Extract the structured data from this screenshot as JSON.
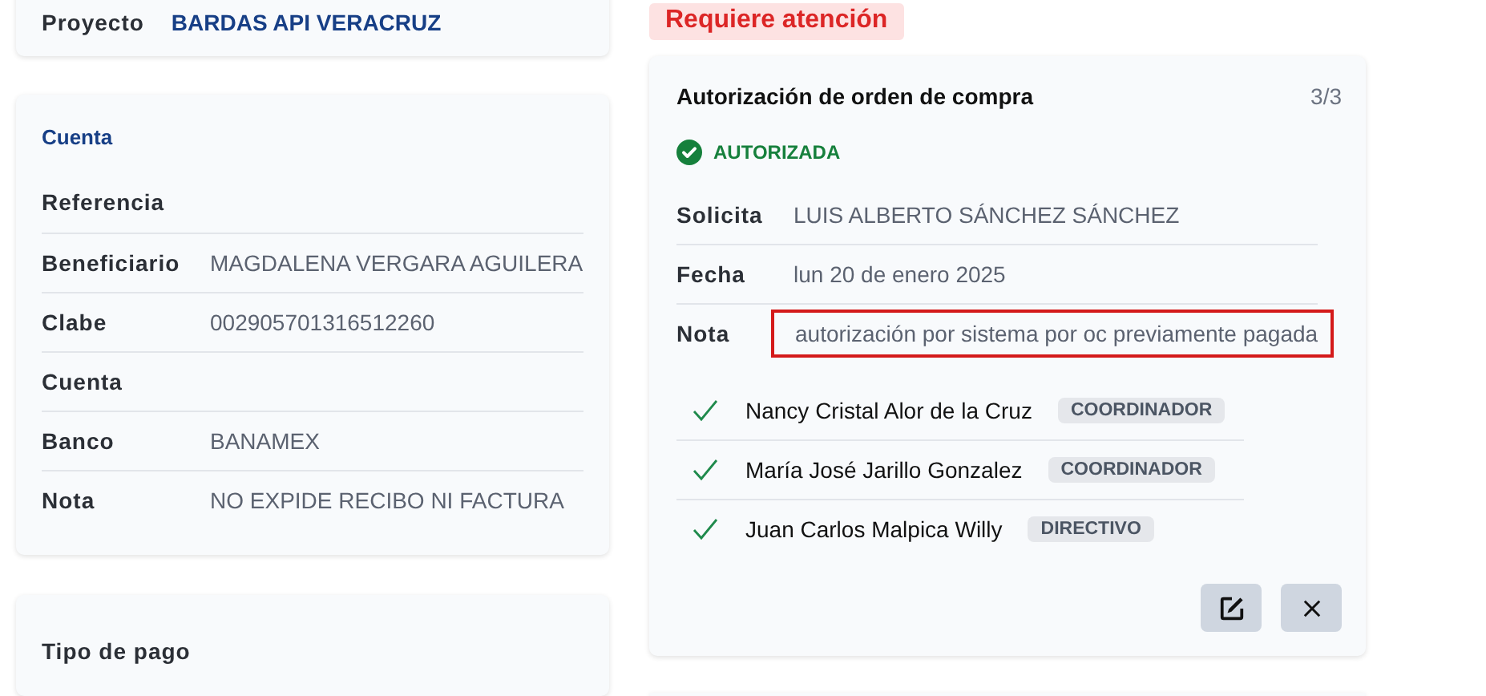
{
  "project": {
    "label": "Proyecto",
    "value": "BARDAS API VERACRUZ"
  },
  "account": {
    "title": "Cuenta",
    "rows": [
      {
        "label": "Referencia"
      },
      {
        "label": "Beneficiario",
        "value": "MAGDALENA VERGARA AGUILERA"
      },
      {
        "label": "Clabe",
        "value": "002905701316512260"
      },
      {
        "label": "Cuenta"
      },
      {
        "label": "Banco",
        "value": "BANAMEX"
      },
      {
        "label": "Nota",
        "value": "NO EXPIDE RECIBO NI FACTURA"
      }
    ]
  },
  "payment": {
    "title": "Tipo de pago"
  },
  "alert_badge": "Requiere atención",
  "authorization": {
    "title": "Autorización de orden de compra",
    "count": "3/3",
    "status": "AUTORIZADA",
    "authorized": true,
    "rows": [
      {
        "label": "Solicita",
        "value": "LUIS ALBERTO SÁNCHEZ SÁNCHEZ",
        "highlighted": false
      },
      {
        "label": "Fecha",
        "value": "lun 20 de enero 2025",
        "highlighted": false
      },
      {
        "label": "Nota",
        "value": "autorización por sistema por oc previamente pagada",
        "highlighted": true
      }
    ],
    "signers": [
      {
        "name": "Nancy Cristal Alor de la Cruz",
        "role": "COORDINADOR",
        "approved": true
      },
      {
        "name": "María José Jarillo Gonzalez",
        "role": "COORDINADOR",
        "approved": true
      },
      {
        "name": "Juan Carlos Malpica Willy",
        "role": "DIRECTIVO",
        "approved": true
      }
    ]
  }
}
